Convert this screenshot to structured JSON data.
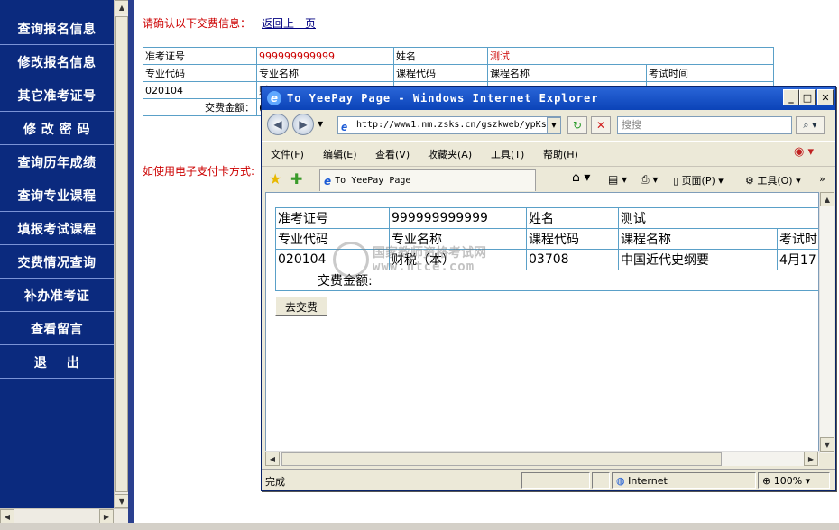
{
  "nav": {
    "items": [
      {
        "label": "查询报名信息"
      },
      {
        "label": "修改报名信息"
      },
      {
        "label": "其它准考证号"
      },
      {
        "label": "修 改 密 码"
      },
      {
        "label": "查询历年成绩"
      },
      {
        "label": "查询专业课程"
      },
      {
        "label": "填报考试课程"
      },
      {
        "label": "交费情况查询"
      },
      {
        "label": "补办准考证"
      },
      {
        "label": "查看留言"
      },
      {
        "label": "退    出"
      }
    ]
  },
  "main": {
    "confirm_title": "请确认以下交费信息：",
    "back_link": "返回上一页",
    "table": {
      "row1": [
        "准考证号",
        "999999999999",
        "姓名",
        "测试"
      ],
      "row2": [
        "专业代码",
        "专业名称",
        "课程代码",
        "课程名称",
        "考试时间"
      ],
      "row3": [
        "020104",
        "财"
      ],
      "fee_label": "交费金额：",
      "fee_value": "("
    },
    "card_note": "如使用电子支付卡方式:"
  },
  "ie": {
    "title": "To YeePay Page - Windows Internet Explorer",
    "address": "http://www1.nm.zsks.cn/gszkweb/ypKs",
    "search_placeholder": "搜搜",
    "menus": [
      "文件(F)",
      "编辑(E)",
      "查看(V)",
      "收藏夹(A)",
      "工具(T)",
      "帮助(H)"
    ],
    "tab_title": "To YeePay Page",
    "toolbar": {
      "page": "页面(P)",
      "tools": "工具(O)"
    },
    "content": {
      "row1": [
        "准考证号",
        "999999999999",
        "姓名",
        "测试"
      ],
      "row2": [
        "专业代码",
        "专业名称",
        "课程代码",
        "课程名称",
        "考试时"
      ],
      "row3": [
        "020104",
        "财税（本）",
        "03708",
        "中国近代史纲要",
        "4月17"
      ],
      "fee_label": "交费金额:"
    },
    "pay_button": "去交费",
    "status": {
      "text": "完成",
      "zone": "Internet",
      "zoom": "100%"
    }
  },
  "watermark": {
    "line1": "国家教师资格考试网",
    "line2": "www.htce.com"
  }
}
